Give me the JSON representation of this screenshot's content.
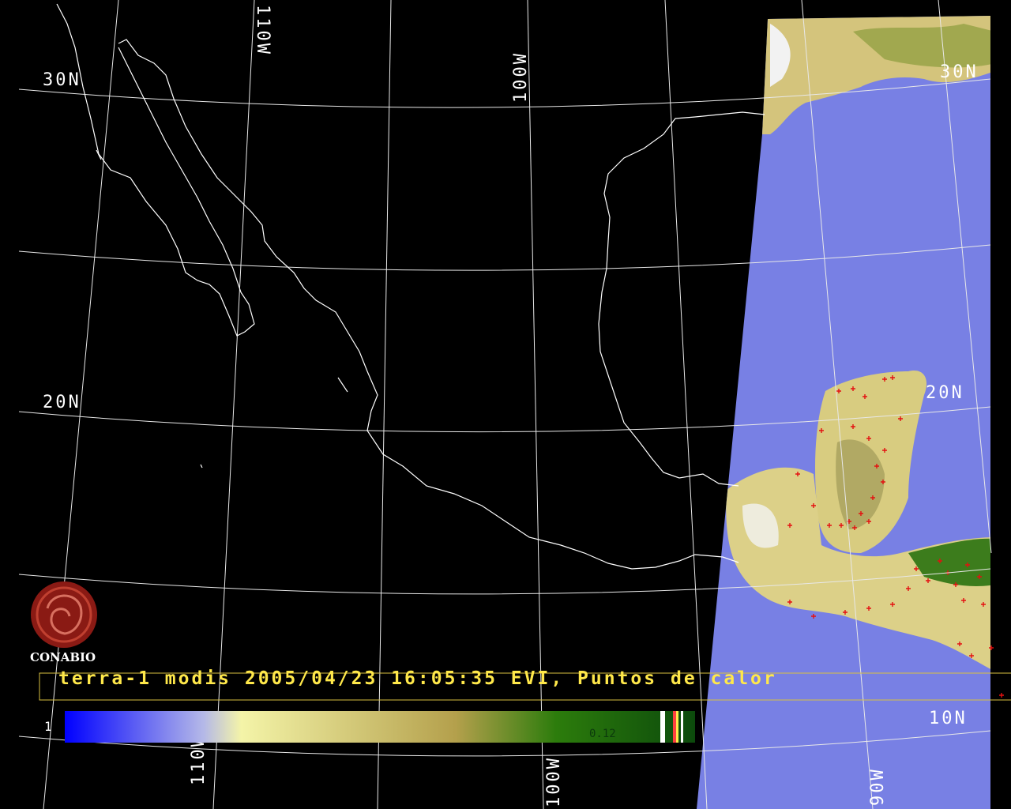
{
  "banner": {
    "text": "terra-1 modis 2005/04/23 16:05:35 EVI, Puntos de calor"
  },
  "logo": {
    "name": "CONABIO",
    "color": "#8a1a14"
  },
  "grid_labels": {
    "lat_30": "30N",
    "lat_20": "20N",
    "lat_20_right": "20N",
    "lat_10_right": "10N",
    "lat_30_right": "30N",
    "lon_110": "110W",
    "lon_100": "100W",
    "lon_90": "90W",
    "lon_100_bottom": "100W",
    "lon_110_bottom": "110W"
  },
  "colorbar": {
    "min_label": "1",
    "max_label": "0.12",
    "stops": [
      "#0000ff",
      "#b4b8e8",
      "#f4f4a8",
      "#b4a04c",
      "#2c7c0c",
      "#0c4a0c"
    ]
  },
  "swath": {
    "ocean_color": "#7880e4",
    "land_color": "#d8cc80",
    "veg_color": "#3c7c1c",
    "hotspot_color": "#e41010"
  }
}
